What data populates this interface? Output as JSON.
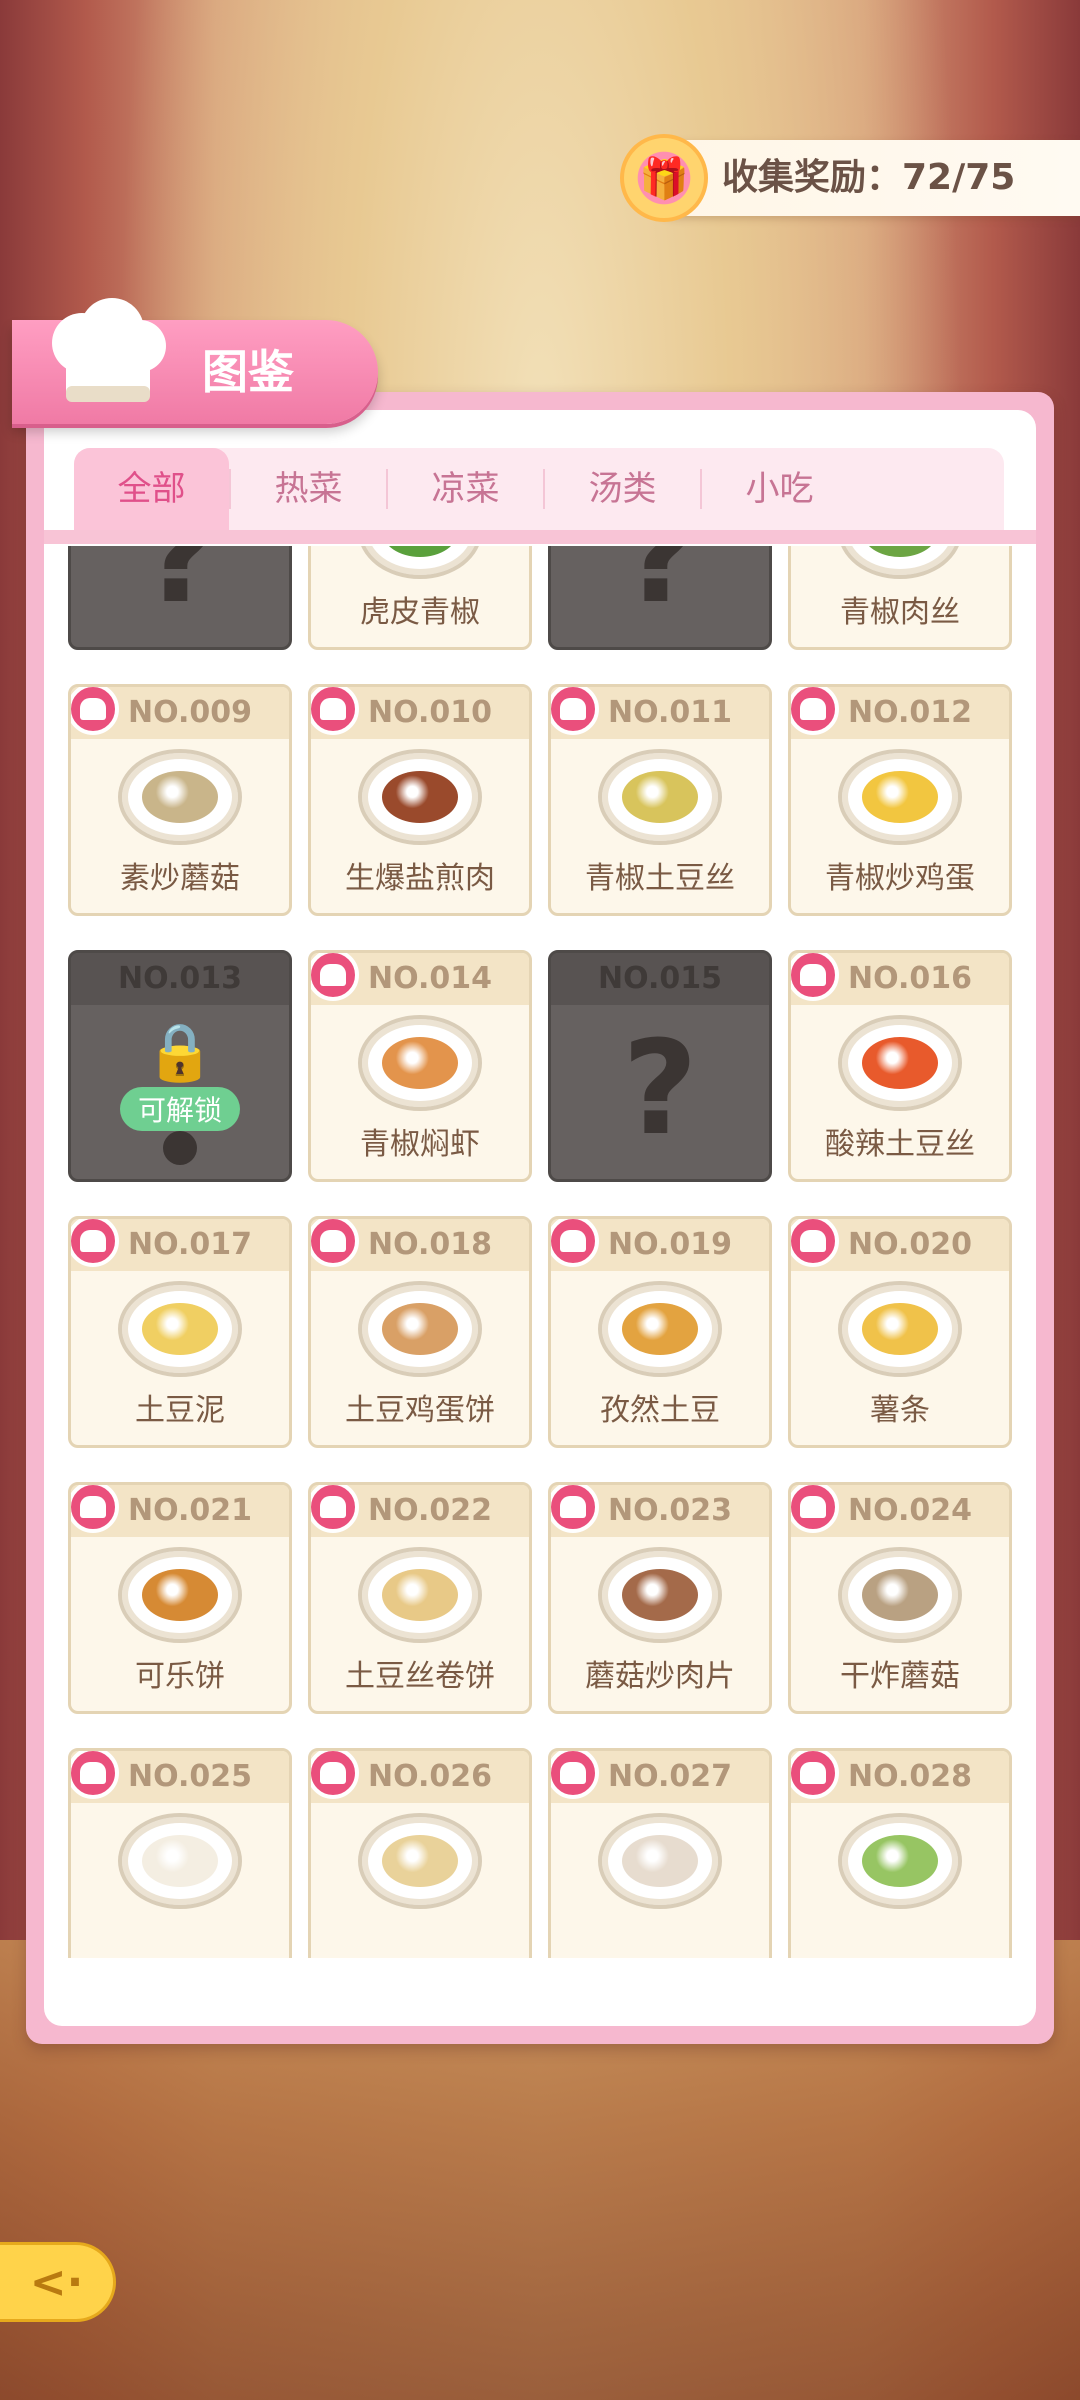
{
  "reward": {
    "label": "收集奖励：72/75"
  },
  "panel": {
    "title": "图鉴"
  },
  "tabs": [
    {
      "label": "全部",
      "active": true
    },
    {
      "label": "热菜"
    },
    {
      "label": "凉菜"
    },
    {
      "label": "汤类"
    },
    {
      "label": "小吃"
    }
  ],
  "dishes": [
    {
      "no": "",
      "name": "",
      "state": "locked"
    },
    {
      "no": "",
      "name": "虎皮青椒",
      "state": "collected",
      "color": "#5aa03c"
    },
    {
      "no": "",
      "name": "",
      "state": "locked"
    },
    {
      "no": "",
      "name": "青椒肉丝",
      "state": "collected",
      "color": "#6ca543"
    },
    {
      "no": "NO.009",
      "name": "素炒蘑菇",
      "state": "collected",
      "color": "#c9b58a"
    },
    {
      "no": "NO.010",
      "name": "生爆盐煎肉",
      "state": "collected",
      "color": "#9a4a2c"
    },
    {
      "no": "NO.011",
      "name": "青椒土豆丝",
      "state": "collected",
      "color": "#d8c45c"
    },
    {
      "no": "NO.012",
      "name": "青椒炒鸡蛋",
      "state": "collected",
      "color": "#f2c640"
    },
    {
      "no": "NO.013",
      "name": "",
      "state": "unlockable",
      "unlock_label": "可解锁"
    },
    {
      "no": "NO.014",
      "name": "青椒焖虾",
      "state": "collected",
      "color": "#e3944c"
    },
    {
      "no": "NO.015",
      "name": "",
      "state": "locked"
    },
    {
      "no": "NO.016",
      "name": "酸辣土豆丝",
      "state": "collected",
      "color": "#e85a2c"
    },
    {
      "no": "NO.017",
      "name": "土豆泥",
      "state": "collected",
      "color": "#f0cf62"
    },
    {
      "no": "NO.018",
      "name": "土豆鸡蛋饼",
      "state": "collected",
      "color": "#d9a066"
    },
    {
      "no": "NO.019",
      "name": "孜然土豆",
      "state": "collected",
      "color": "#e3a340"
    },
    {
      "no": "NO.020",
      "name": "薯条",
      "state": "collected",
      "color": "#f0c24a"
    },
    {
      "no": "NO.021",
      "name": "可乐饼",
      "state": "collected",
      "color": "#d68a34"
    },
    {
      "no": "NO.022",
      "name": "土豆丝卷饼",
      "state": "collected",
      "color": "#e8c987"
    },
    {
      "no": "NO.023",
      "name": "蘑菇炒肉片",
      "state": "collected",
      "color": "#a46a4a"
    },
    {
      "no": "NO.024",
      "name": "干炸蘑菇",
      "state": "collected",
      "color": "#b9a182"
    },
    {
      "no": "NO.025",
      "name": "",
      "state": "collected",
      "color": "#f4eee2"
    },
    {
      "no": "NO.026",
      "name": "",
      "state": "collected",
      "color": "#e9d29a"
    },
    {
      "no": "NO.027",
      "name": "",
      "state": "collected",
      "color": "#e7dccf"
    },
    {
      "no": "NO.028",
      "name": "",
      "state": "collected",
      "color": "#97c563"
    }
  ]
}
